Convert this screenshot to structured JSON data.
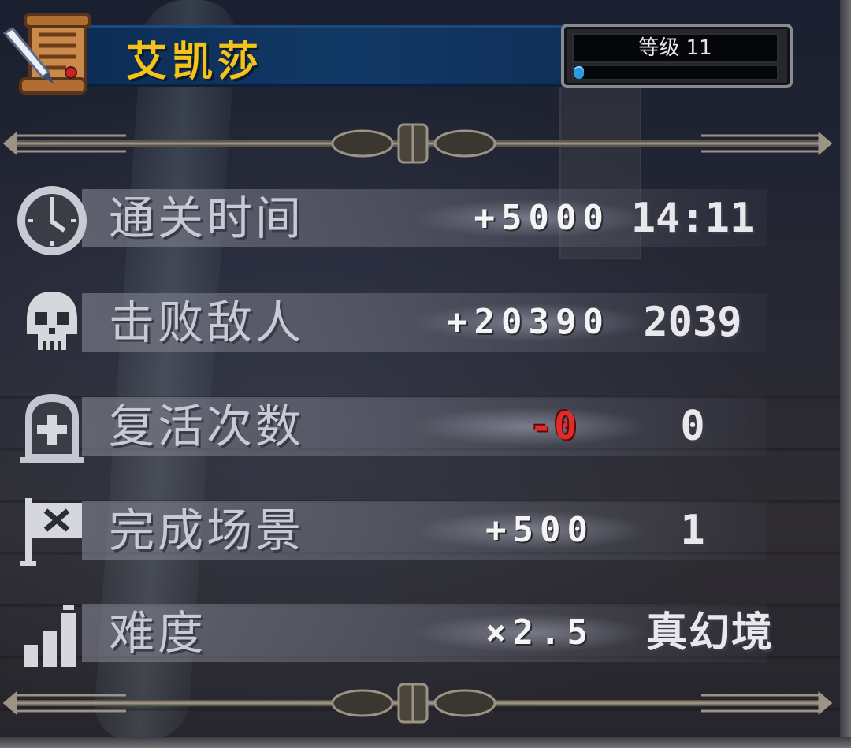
{
  "header": {
    "character_name": "艾凯莎",
    "level_label": "等级 11",
    "level_progress": 0.03
  },
  "stats": [
    {
      "icon": "clock-icon",
      "label": "通关时间",
      "bonus": "+5000",
      "value": "14:11"
    },
    {
      "icon": "skull-icon",
      "label": "击败敌人",
      "bonus": "+20390",
      "value": "2039"
    },
    {
      "icon": "tombstone-icon",
      "label": "复活次数",
      "bonus": "-0",
      "value": "0"
    },
    {
      "icon": "flag-icon",
      "label": "完成场景",
      "bonus": "+500",
      "value": "1"
    },
    {
      "icon": "difficulty-bars-icon",
      "label": "难度",
      "bonus": "×2.5",
      "value": "真幻境"
    }
  ],
  "colors": {
    "name": "#f3c31a",
    "banner": "#123966",
    "label": "#c9cad6",
    "penalty": "#e12b2b",
    "xp_bar": "#2a9be0"
  }
}
